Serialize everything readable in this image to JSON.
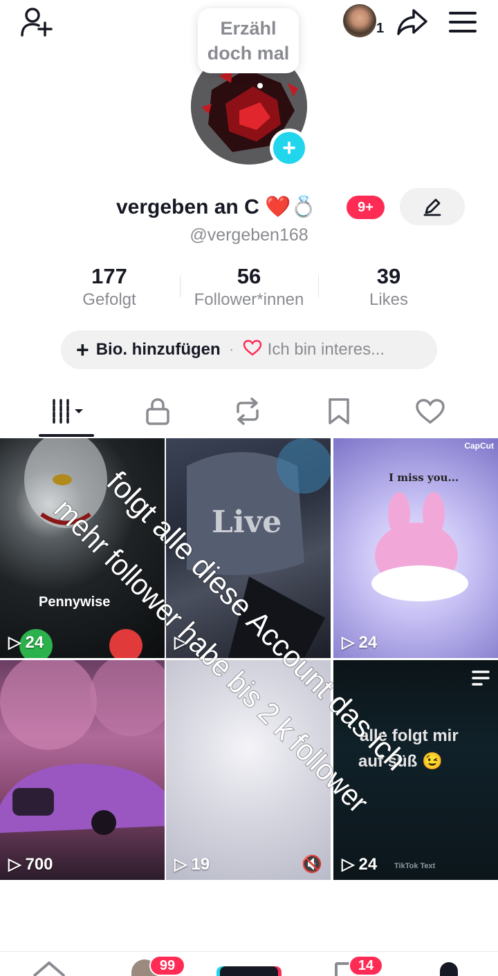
{
  "tooltip": {
    "line1": "Erzähl",
    "line2": "doch mal"
  },
  "top_bar": {
    "avatar_count": "1"
  },
  "profile": {
    "display_name": "vergeben an C ❤️💍",
    "notification_badge": "9+",
    "username": "@vergeben168"
  },
  "stats": [
    {
      "value": "177",
      "label": "Gefolgt"
    },
    {
      "value": "56",
      "label": "Follower*innen"
    },
    {
      "value": "39",
      "label": "Likes"
    }
  ],
  "bio": {
    "add_label": "Bio. hinzufügen",
    "separator": "·",
    "interest_label": "Ich bin interes..."
  },
  "videos": [
    {
      "views": "24",
      "caption": "Pennywise"
    },
    {
      "views": "",
      "caption": "Live"
    },
    {
      "views": "24",
      "caption": "I miss you...",
      "watermark": "CapCut"
    },
    {
      "views": "700"
    },
    {
      "views": "19"
    },
    {
      "views": "24",
      "caption_line1": "alle folgt mir",
      "caption_line2": "auf süß 😉",
      "watermark": "TikTok Text"
    }
  ],
  "overlay_text": {
    "line1": "folgt alle diese Account das ich",
    "line2": "mehr follower habe bis 2 k follower"
  },
  "bottom_nav": {
    "inbox_badge": "99",
    "messages_badge": "14"
  },
  "colors": {
    "accent_red": "#fe2c55",
    "accent_cyan": "#20d5ec",
    "text_primary": "#161823",
    "text_secondary": "#8a8b91"
  }
}
